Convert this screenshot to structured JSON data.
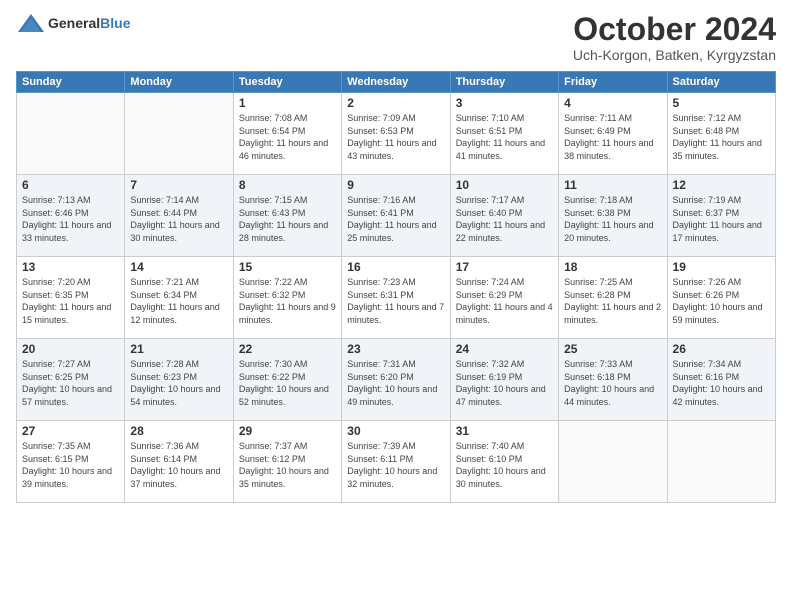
{
  "header": {
    "logo_general": "General",
    "logo_blue": "Blue",
    "month": "October 2024",
    "location": "Uch-Korgon, Batken, Kyrgyzstan"
  },
  "weekdays": [
    "Sunday",
    "Monday",
    "Tuesday",
    "Wednesday",
    "Thursday",
    "Friday",
    "Saturday"
  ],
  "weeks": [
    [
      {
        "day": "",
        "sunrise": "",
        "sunset": "",
        "daylight": ""
      },
      {
        "day": "",
        "sunrise": "",
        "sunset": "",
        "daylight": ""
      },
      {
        "day": "1",
        "sunrise": "Sunrise: 7:08 AM",
        "sunset": "Sunset: 6:54 PM",
        "daylight": "Daylight: 11 hours and 46 minutes."
      },
      {
        "day": "2",
        "sunrise": "Sunrise: 7:09 AM",
        "sunset": "Sunset: 6:53 PM",
        "daylight": "Daylight: 11 hours and 43 minutes."
      },
      {
        "day": "3",
        "sunrise": "Sunrise: 7:10 AM",
        "sunset": "Sunset: 6:51 PM",
        "daylight": "Daylight: 11 hours and 41 minutes."
      },
      {
        "day": "4",
        "sunrise": "Sunrise: 7:11 AM",
        "sunset": "Sunset: 6:49 PM",
        "daylight": "Daylight: 11 hours and 38 minutes."
      },
      {
        "day": "5",
        "sunrise": "Sunrise: 7:12 AM",
        "sunset": "Sunset: 6:48 PM",
        "daylight": "Daylight: 11 hours and 35 minutes."
      }
    ],
    [
      {
        "day": "6",
        "sunrise": "Sunrise: 7:13 AM",
        "sunset": "Sunset: 6:46 PM",
        "daylight": "Daylight: 11 hours and 33 minutes."
      },
      {
        "day": "7",
        "sunrise": "Sunrise: 7:14 AM",
        "sunset": "Sunset: 6:44 PM",
        "daylight": "Daylight: 11 hours and 30 minutes."
      },
      {
        "day": "8",
        "sunrise": "Sunrise: 7:15 AM",
        "sunset": "Sunset: 6:43 PM",
        "daylight": "Daylight: 11 hours and 28 minutes."
      },
      {
        "day": "9",
        "sunrise": "Sunrise: 7:16 AM",
        "sunset": "Sunset: 6:41 PM",
        "daylight": "Daylight: 11 hours and 25 minutes."
      },
      {
        "day": "10",
        "sunrise": "Sunrise: 7:17 AM",
        "sunset": "Sunset: 6:40 PM",
        "daylight": "Daylight: 11 hours and 22 minutes."
      },
      {
        "day": "11",
        "sunrise": "Sunrise: 7:18 AM",
        "sunset": "Sunset: 6:38 PM",
        "daylight": "Daylight: 11 hours and 20 minutes."
      },
      {
        "day": "12",
        "sunrise": "Sunrise: 7:19 AM",
        "sunset": "Sunset: 6:37 PM",
        "daylight": "Daylight: 11 hours and 17 minutes."
      }
    ],
    [
      {
        "day": "13",
        "sunrise": "Sunrise: 7:20 AM",
        "sunset": "Sunset: 6:35 PM",
        "daylight": "Daylight: 11 hours and 15 minutes."
      },
      {
        "day": "14",
        "sunrise": "Sunrise: 7:21 AM",
        "sunset": "Sunset: 6:34 PM",
        "daylight": "Daylight: 11 hours and 12 minutes."
      },
      {
        "day": "15",
        "sunrise": "Sunrise: 7:22 AM",
        "sunset": "Sunset: 6:32 PM",
        "daylight": "Daylight: 11 hours and 9 minutes."
      },
      {
        "day": "16",
        "sunrise": "Sunrise: 7:23 AM",
        "sunset": "Sunset: 6:31 PM",
        "daylight": "Daylight: 11 hours and 7 minutes."
      },
      {
        "day": "17",
        "sunrise": "Sunrise: 7:24 AM",
        "sunset": "Sunset: 6:29 PM",
        "daylight": "Daylight: 11 hours and 4 minutes."
      },
      {
        "day": "18",
        "sunrise": "Sunrise: 7:25 AM",
        "sunset": "Sunset: 6:28 PM",
        "daylight": "Daylight: 11 hours and 2 minutes."
      },
      {
        "day": "19",
        "sunrise": "Sunrise: 7:26 AM",
        "sunset": "Sunset: 6:26 PM",
        "daylight": "Daylight: 10 hours and 59 minutes."
      }
    ],
    [
      {
        "day": "20",
        "sunrise": "Sunrise: 7:27 AM",
        "sunset": "Sunset: 6:25 PM",
        "daylight": "Daylight: 10 hours and 57 minutes."
      },
      {
        "day": "21",
        "sunrise": "Sunrise: 7:28 AM",
        "sunset": "Sunset: 6:23 PM",
        "daylight": "Daylight: 10 hours and 54 minutes."
      },
      {
        "day": "22",
        "sunrise": "Sunrise: 7:30 AM",
        "sunset": "Sunset: 6:22 PM",
        "daylight": "Daylight: 10 hours and 52 minutes."
      },
      {
        "day": "23",
        "sunrise": "Sunrise: 7:31 AM",
        "sunset": "Sunset: 6:20 PM",
        "daylight": "Daylight: 10 hours and 49 minutes."
      },
      {
        "day": "24",
        "sunrise": "Sunrise: 7:32 AM",
        "sunset": "Sunset: 6:19 PM",
        "daylight": "Daylight: 10 hours and 47 minutes."
      },
      {
        "day": "25",
        "sunrise": "Sunrise: 7:33 AM",
        "sunset": "Sunset: 6:18 PM",
        "daylight": "Daylight: 10 hours and 44 minutes."
      },
      {
        "day": "26",
        "sunrise": "Sunrise: 7:34 AM",
        "sunset": "Sunset: 6:16 PM",
        "daylight": "Daylight: 10 hours and 42 minutes."
      }
    ],
    [
      {
        "day": "27",
        "sunrise": "Sunrise: 7:35 AM",
        "sunset": "Sunset: 6:15 PM",
        "daylight": "Daylight: 10 hours and 39 minutes."
      },
      {
        "day": "28",
        "sunrise": "Sunrise: 7:36 AM",
        "sunset": "Sunset: 6:14 PM",
        "daylight": "Daylight: 10 hours and 37 minutes."
      },
      {
        "day": "29",
        "sunrise": "Sunrise: 7:37 AM",
        "sunset": "Sunset: 6:12 PM",
        "daylight": "Daylight: 10 hours and 35 minutes."
      },
      {
        "day": "30",
        "sunrise": "Sunrise: 7:39 AM",
        "sunset": "Sunset: 6:11 PM",
        "daylight": "Daylight: 10 hours and 32 minutes."
      },
      {
        "day": "31",
        "sunrise": "Sunrise: 7:40 AM",
        "sunset": "Sunset: 6:10 PM",
        "daylight": "Daylight: 10 hours and 30 minutes."
      },
      {
        "day": "",
        "sunrise": "",
        "sunset": "",
        "daylight": ""
      },
      {
        "day": "",
        "sunrise": "",
        "sunset": "",
        "daylight": ""
      }
    ]
  ]
}
